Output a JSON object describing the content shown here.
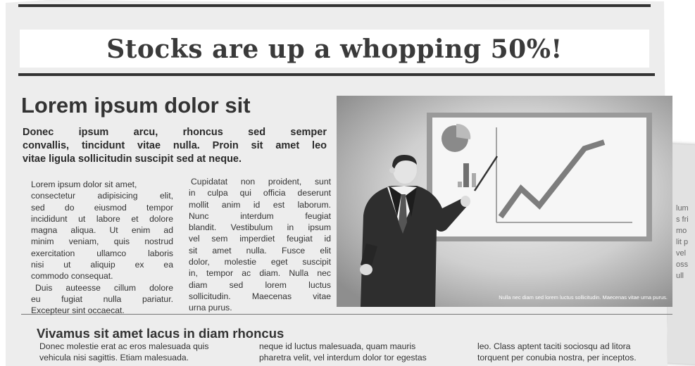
{
  "headline": "Stocks are up a whopping 50%!",
  "article": {
    "title": "Lorem ipsum dolor sit",
    "lead": [
      "Donec ipsum arcu, rhoncus sed semper",
      "convallis, tincidunt vitae nulla. Proin sit amet leo",
      "vitae ligula sollicitudin suscipit sed at neque."
    ],
    "col1": [
      "Lorem ipsum dolor sit amet,",
      "consectetur adipisicing elit,",
      "sed do eiusmod tempor",
      "incididunt ut labore et dolore",
      "magna aliqua. Ut enim ad",
      "minim veniam, quis nostrud",
      "exercitation ullamco laboris",
      "nisi ut aliquip ex ea",
      "commodo consequat.",
      "Duis auteesse cillum dolore",
      "eu fugiat nulla pariatur.",
      "Excepteur sint occaecat."
    ],
    "col2": [
      "Cupidatat non proident, sunt",
      "in culpa qui officia deserunt",
      "mollit anim id est laborum.",
      "Nunc interdum feugiat",
      "blandit. Vestibulum in ipsum",
      "vel sem imperdiet feugiat id",
      "sit amet nulla. Fusce elit",
      "dolor, molestie eget suscipit",
      "in, tempor ac diam. Nulla nec",
      "diam sed lorem luctus",
      "sollicitudin. Maecenas vitae",
      "urna purus."
    ],
    "photo_caption": "Nulla nec diam sed lorem luctus sollicitudin. Maecenas vitae urna purus."
  },
  "bottom": {
    "title": "Vivamus sit amet lacus in diam rhoncus",
    "col1": [
      "Donec molestie erat ac eros malesuada quis",
      "vehicula nisi sagittis. Etiam malesuada."
    ],
    "col2": [
      "neque id luctus malesuada, quam mauris",
      "pharetra velit, vel interdum dolor tor egestas"
    ],
    "col3": [
      "leo. Class aptent taciti sociosqu ad litora",
      "torquent per conubia nostra, per inceptos."
    ]
  },
  "back_page_text": [
    "lum",
    "s fri",
    "mo",
    "lit p",
    "vel",
    "oss",
    "ull"
  ]
}
